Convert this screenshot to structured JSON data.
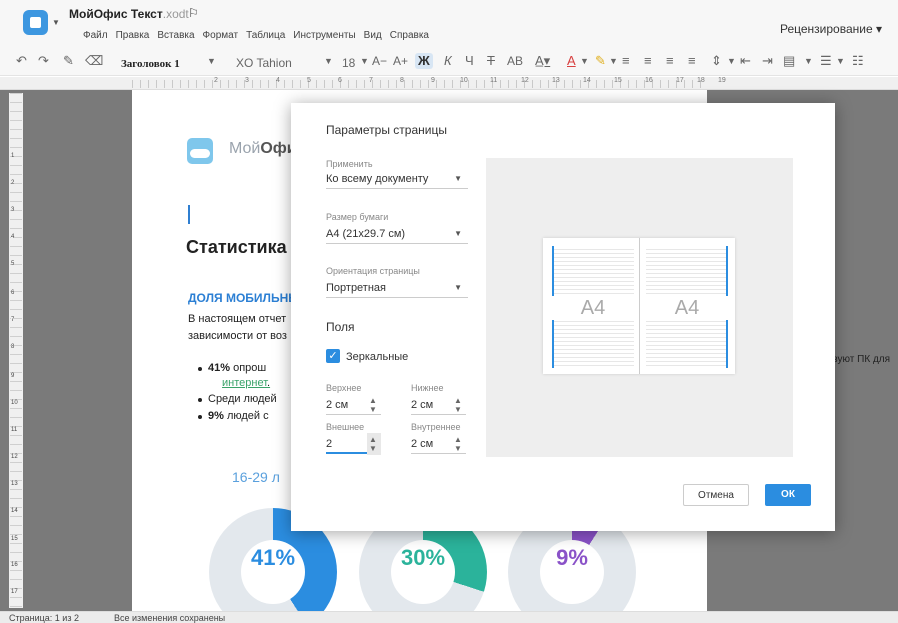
{
  "app": {
    "name": "МойОфис Текст",
    "ext": ".xodt"
  },
  "menu": [
    "Файл",
    "Правка",
    "Вставка",
    "Формат",
    "Таблица",
    "Инструменты",
    "Вид",
    "Справка"
  ],
  "review": "Рецензирование ▾",
  "toolbar": {
    "style": "Заголовок 1",
    "font": "XO Tahion",
    "size": "18",
    "font_inc": "A+",
    "font_dec": "A−",
    "bold": "Ж",
    "italic": "К",
    "underline": "Ч",
    "strike": "Т",
    "caps": "АВ"
  },
  "ruler": {
    "marks": [
      "1",
      "2",
      "3",
      "4",
      "5",
      "6",
      "7",
      "8",
      "9",
      "10",
      "11",
      "12",
      "13",
      "14",
      "15",
      "16",
      "17",
      "18",
      "19"
    ],
    "vmarks": [
      "1",
      "2",
      "3",
      "4",
      "5",
      "6",
      "7",
      "8",
      "9",
      "10",
      "11",
      "12",
      "13",
      "14",
      "15",
      "16",
      "17"
    ]
  },
  "document": {
    "logo_text_light": "Мой",
    "logo_text_bold": "Офи",
    "heading": "Статистика",
    "subheading": "ДОЛЯ МОБИЛЬНЫ",
    "para_line1": "В настоящем отчет",
    "para_line2": "зависимости от воз",
    "bullets": [
      {
        "bold": "41%",
        "text": " опрош"
      },
      {
        "bold": "",
        "text": "Среди людей"
      },
      {
        "bold": "9%",
        "text": " людей с"
      }
    ],
    "link": "интернет",
    "link_tail": ".",
    "age_head": "16-29 л",
    "side_text": "льзуют ПК для",
    "pies": [
      {
        "label": "41%",
        "percent": 41,
        "color": "#2b8de0"
      },
      {
        "label": "30%",
        "percent": 30,
        "color": "#2bb39b"
      },
      {
        "label": "9%",
        "percent": 9,
        "color": "#8a52c8"
      }
    ]
  },
  "status": {
    "page": "Страница: 1 из 2",
    "saved": "Все изменения сохранены"
  },
  "dialog": {
    "title": "Параметры страницы",
    "apply_label": "Применить",
    "apply_value": "Ко всему документу",
    "paper_label": "Размер бумаги",
    "paper_value": "А4 (21x29.7 см)",
    "orient_label": "Ориентация страницы",
    "orient_value": "Портретная",
    "margins_title": "Поля",
    "mirror_label": "Зеркальные",
    "mirror_checked": true,
    "top_label": "Верхнее",
    "top_value": "2 см",
    "bottom_label": "Нижнее",
    "bottom_value": "2 см",
    "outer_label": "Внешнее",
    "outer_value": "2",
    "inner_label": "Внутреннее",
    "inner_value": "2 см",
    "preview_left": "A4",
    "preview_right": "A4",
    "cancel": "Отмена",
    "ok": "ОК"
  },
  "colors": {
    "accent": "#2b8de0",
    "overlay": "#7a7a7a"
  }
}
